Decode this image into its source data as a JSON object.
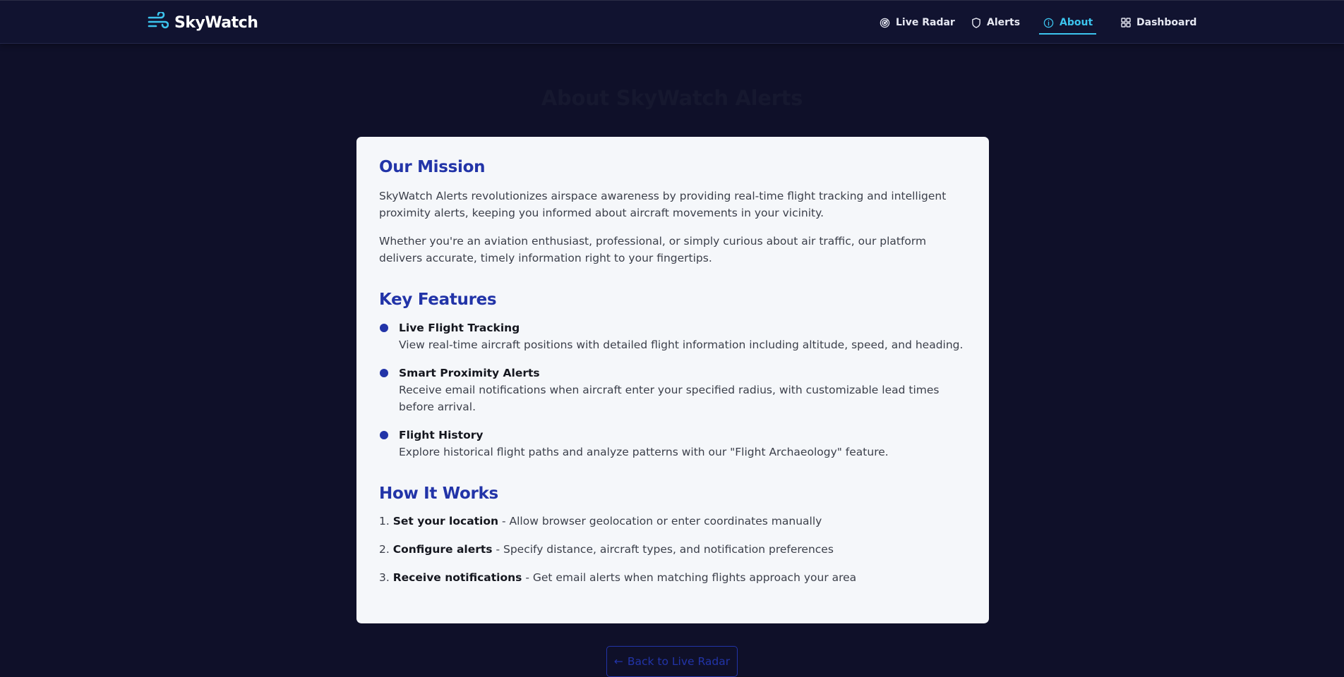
{
  "header": {
    "brand": "SkyWatch",
    "nav": [
      {
        "label": "Live Radar",
        "icon": "radar-icon"
      },
      {
        "label": "Alerts",
        "icon": "shield-icon"
      },
      {
        "label": "About",
        "icon": "info-icon",
        "active": true
      },
      {
        "label": "Dashboard",
        "icon": "grid-icon"
      }
    ]
  },
  "page": {
    "title": "About SkyWatch Alerts"
  },
  "mission": {
    "title": "Our Mission",
    "paragraphs": [
      "SkyWatch Alerts revolutionizes airspace awareness by providing real-time flight tracking and intelligent proximity alerts, keeping you informed about aircraft movements in your vicinity.",
      "Whether you're an aviation enthusiast, professional, or simply curious about air traffic, our platform delivers accurate, timely information right to your fingertips."
    ]
  },
  "features": {
    "title": "Key Features",
    "items": [
      {
        "title": "Live Flight Tracking",
        "desc": "View real-time aircraft positions with detailed flight information including altitude, speed, and heading."
      },
      {
        "title": "Smart Proximity Alerts",
        "desc": "Receive email notifications when aircraft enter your specified radius, with customizable lead times before arrival."
      },
      {
        "title": "Flight History",
        "desc": "Explore historical flight paths and analyze patterns with our \"Flight Archaeology\" feature."
      }
    ]
  },
  "how": {
    "title": "How It Works",
    "steps": [
      {
        "num": "1.",
        "bold": "Set your location",
        "rest": " - Allow browser geolocation or enter coordinates manually"
      },
      {
        "num": "2.",
        "bold": "Configure alerts",
        "rest": " - Specify distance, aircraft types, and notification preferences"
      },
      {
        "num": "3.",
        "bold": "Receive notifications",
        "rest": " - Get email alerts when matching flights approach your area"
      }
    ]
  },
  "back_button": {
    "label": "Back to Live Radar",
    "icon": "arrow-left-icon"
  },
  "colors": {
    "background": "#0f1029",
    "accent": "#3cc4ee",
    "heading": "#2234a8",
    "card": "#f5f7fa"
  }
}
